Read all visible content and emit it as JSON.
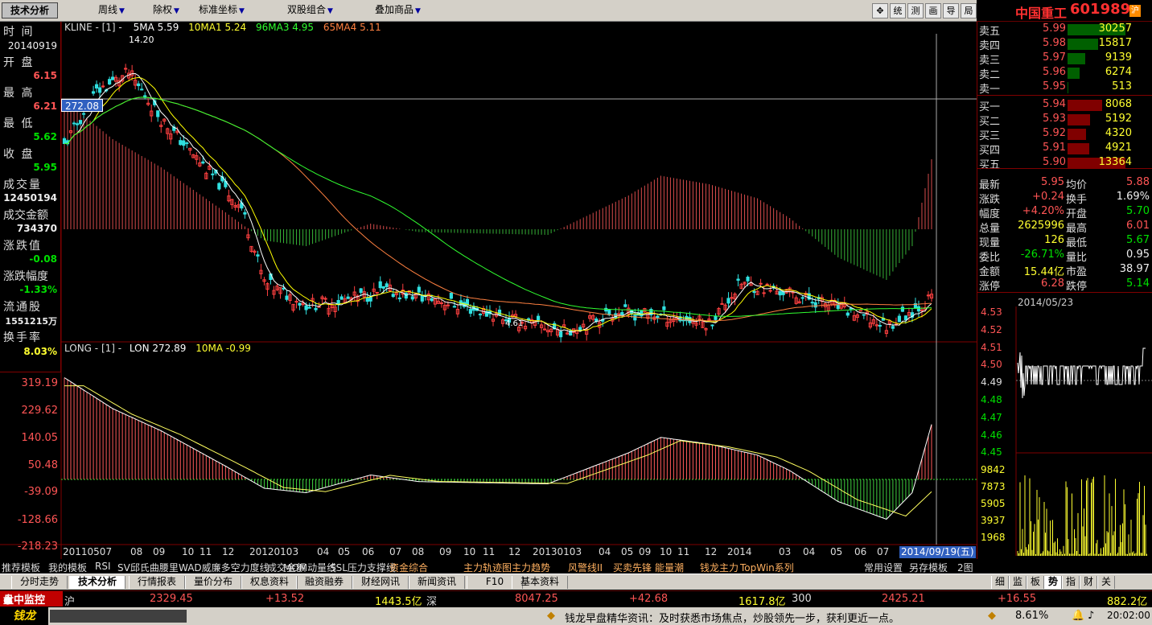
{
  "toolbar": {
    "active_tab": "技术分析",
    "menus": [
      "周线",
      "除权",
      "标准坐标",
      "双股组合",
      "叠加商品"
    ],
    "tools": [
      "统",
      "测",
      "画",
      "导",
      "局"
    ]
  },
  "stock": {
    "name": "中国重工",
    "code": "601989",
    "market_badge": "沪"
  },
  "left_info": {
    "time_label": "时  间",
    "time": "20140919",
    "open_label": "开  盘",
    "open": "6.15",
    "high_label": "最  高",
    "high": "6.21",
    "low_label": "最  低",
    "low": "5.62",
    "close_label": "收  盘",
    "close": "5.95",
    "volume_label": "成交量",
    "volume": "12450194",
    "amount_label": "成交金额",
    "amount": "734370",
    "change_label": "涨跌值",
    "change": "-0.08",
    "change_pct_label": "涨跌幅度",
    "change_pct": "-1.33%",
    "float_label": "流通股",
    "float": "1551215万",
    "turnover_label": "换手率",
    "turnover": "8.03%"
  },
  "kline": {
    "title": "KLINE - [1] -",
    "ma": [
      "5MA 5.59",
      "10MA1 5.24",
      "96MA3 4.95",
      "65MA4 5.11"
    ],
    "ma_colors": [
      "#ffffff",
      "#ffff00",
      "#00ff00",
      "#ff8040"
    ],
    "high_label": "14.20",
    "cursor_price": "272.08",
    "low_label": "4.61"
  },
  "lon": {
    "title": "LONG - [1] -",
    "value": "LON 272.89",
    "ma": "10MA -0.99",
    "axis": [
      "319.19",
      "229.62",
      "140.05",
      "50.48",
      "-39.09",
      "-128.66",
      "-218.23"
    ]
  },
  "x_axis": {
    "labels": [
      "20110507",
      "08",
      "09",
      "10",
      "11",
      "12",
      "20120103",
      "04",
      "05",
      "06",
      "07",
      "08",
      "09",
      "10",
      "11",
      "12",
      "20130103",
      "04",
      "05",
      "09",
      "10",
      "11",
      "12",
      "2014",
      "03",
      "04",
      "05",
      "06",
      "07"
    ],
    "cursor_date": "2014/09/19(五)"
  },
  "order_book": {
    "asks": [
      {
        "label": "卖五",
        "price": "5.99",
        "vol": "30257"
      },
      {
        "label": "卖四",
        "price": "5.98",
        "vol": "15817"
      },
      {
        "label": "卖三",
        "price": "5.97",
        "vol": "9139"
      },
      {
        "label": "卖二",
        "price": "5.96",
        "vol": "6274"
      },
      {
        "label": "卖一",
        "price": "5.95",
        "vol": "513"
      }
    ],
    "bids": [
      {
        "label": "买一",
        "price": "5.94",
        "vol": "8068"
      },
      {
        "label": "买二",
        "price": "5.93",
        "vol": "5192"
      },
      {
        "label": "买三",
        "price": "5.92",
        "vol": "4320"
      },
      {
        "label": "买四",
        "price": "5.91",
        "vol": "4921"
      },
      {
        "label": "买五",
        "price": "5.90",
        "vol": "13364"
      }
    ]
  },
  "stats": [
    {
      "l1": "最新",
      "v1": "5.95",
      "l2": "均价",
      "v2": "5.88"
    },
    {
      "l1": "涨跌",
      "v1": "+0.24",
      "l2": "换手",
      "v2": "1.69%"
    },
    {
      "l1": "幅度",
      "v1": "+4.20%",
      "l2": "开盘",
      "v2": "5.70"
    },
    {
      "l1": "总量",
      "v1": "2625996",
      "l2": "最高",
      "v2": "6.01"
    },
    {
      "l1": "现量",
      "v1": "126",
      "l2": "最低",
      "v2": "5.67"
    },
    {
      "l1": "委比",
      "v1": "-26.71%",
      "l2": "量比",
      "v2": "0.95"
    },
    {
      "l1": "金额",
      "v1": "15.44亿",
      "l2": "市盈",
      "v2": "38.97"
    },
    {
      "l1": "涨停",
      "v1": "6.28",
      "l2": "跌停",
      "v2": "5.14"
    }
  ],
  "mini_chart": {
    "date": "2014/05/23",
    "price_axis": [
      "4.53",
      "4.52",
      "4.51",
      "4.50",
      "4.49",
      "4.48",
      "4.47",
      "4.46",
      "4.45"
    ],
    "vol_axis": [
      "9842",
      "7873",
      "5905",
      "3937",
      "1968"
    ]
  },
  "formula_tabs": [
    "推荐模板",
    "我的模板",
    "RSI",
    "SV邱氏曲腰里",
    "WAD威廉多空力度线",
    "成交金额",
    "MOM动量线",
    "SSL压力支撑线",
    "资金综合",
    "主力轨迹图",
    "主力趋势",
    "风警线II",
    "买卖先锋",
    "能量潮",
    "钱龙主力",
    "TopWin系列",
    "常用设置",
    "另存模板",
    "2图"
  ],
  "view_tabs": [
    "分时走势",
    "技术分析",
    "行情报表",
    "量价分布",
    "权息资料",
    "融资融券",
    "财经网讯",
    "新闻资讯",
    "F10",
    "基本资料"
  ],
  "right_tabs": [
    "细",
    "监",
    "板",
    "势",
    "指",
    "财",
    "关"
  ],
  "index_bar": [
    {
      "name": "沪",
      "value": "2329.45",
      "change": "+13.52",
      "amount": "1443.5亿"
    },
    {
      "name": "深",
      "value": "8047.25",
      "change": "+42.68",
      "amount": "1617.8亿"
    },
    {
      "name": "300",
      "value": "2425.21",
      "change": "+16.55",
      "amount": "882.2亿"
    }
  ],
  "monitor_label": "盘中监控",
  "status": {
    "logo": "钱龙",
    "news": "钱龙早盘精华资讯：及时获悉市场焦点，炒股领先一步，获利更近一点。",
    "pct": "8.61%",
    "time": "20:02:00"
  }
}
